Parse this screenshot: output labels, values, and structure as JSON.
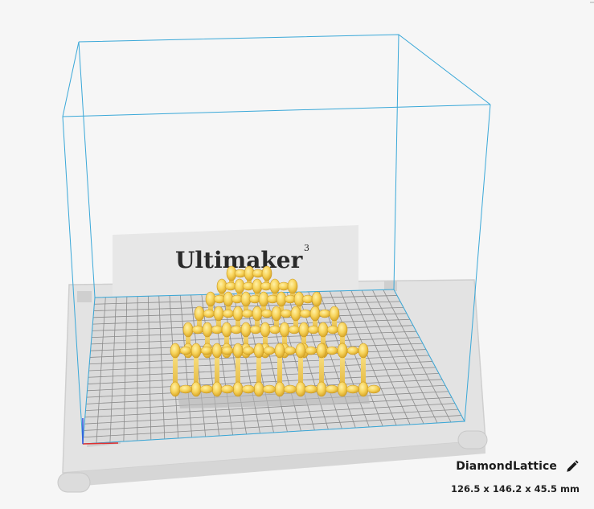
{
  "viewport": {
    "backdrop_brand": "Ultimaker",
    "backdrop_superscript": "3"
  },
  "model_info": {
    "name": "DiamondLattice",
    "dimensions": "126.5 x 146.2 x 45.5 mm"
  },
  "icons": {
    "edit": "pencil-icon"
  },
  "colors": {
    "build_volume_outline": "#3aa8d8",
    "model": "#f7d35a",
    "model_shade": "#d9a92c",
    "plate": "#d2d2d2",
    "grid": "#808080",
    "background": "#f6f6f6"
  }
}
